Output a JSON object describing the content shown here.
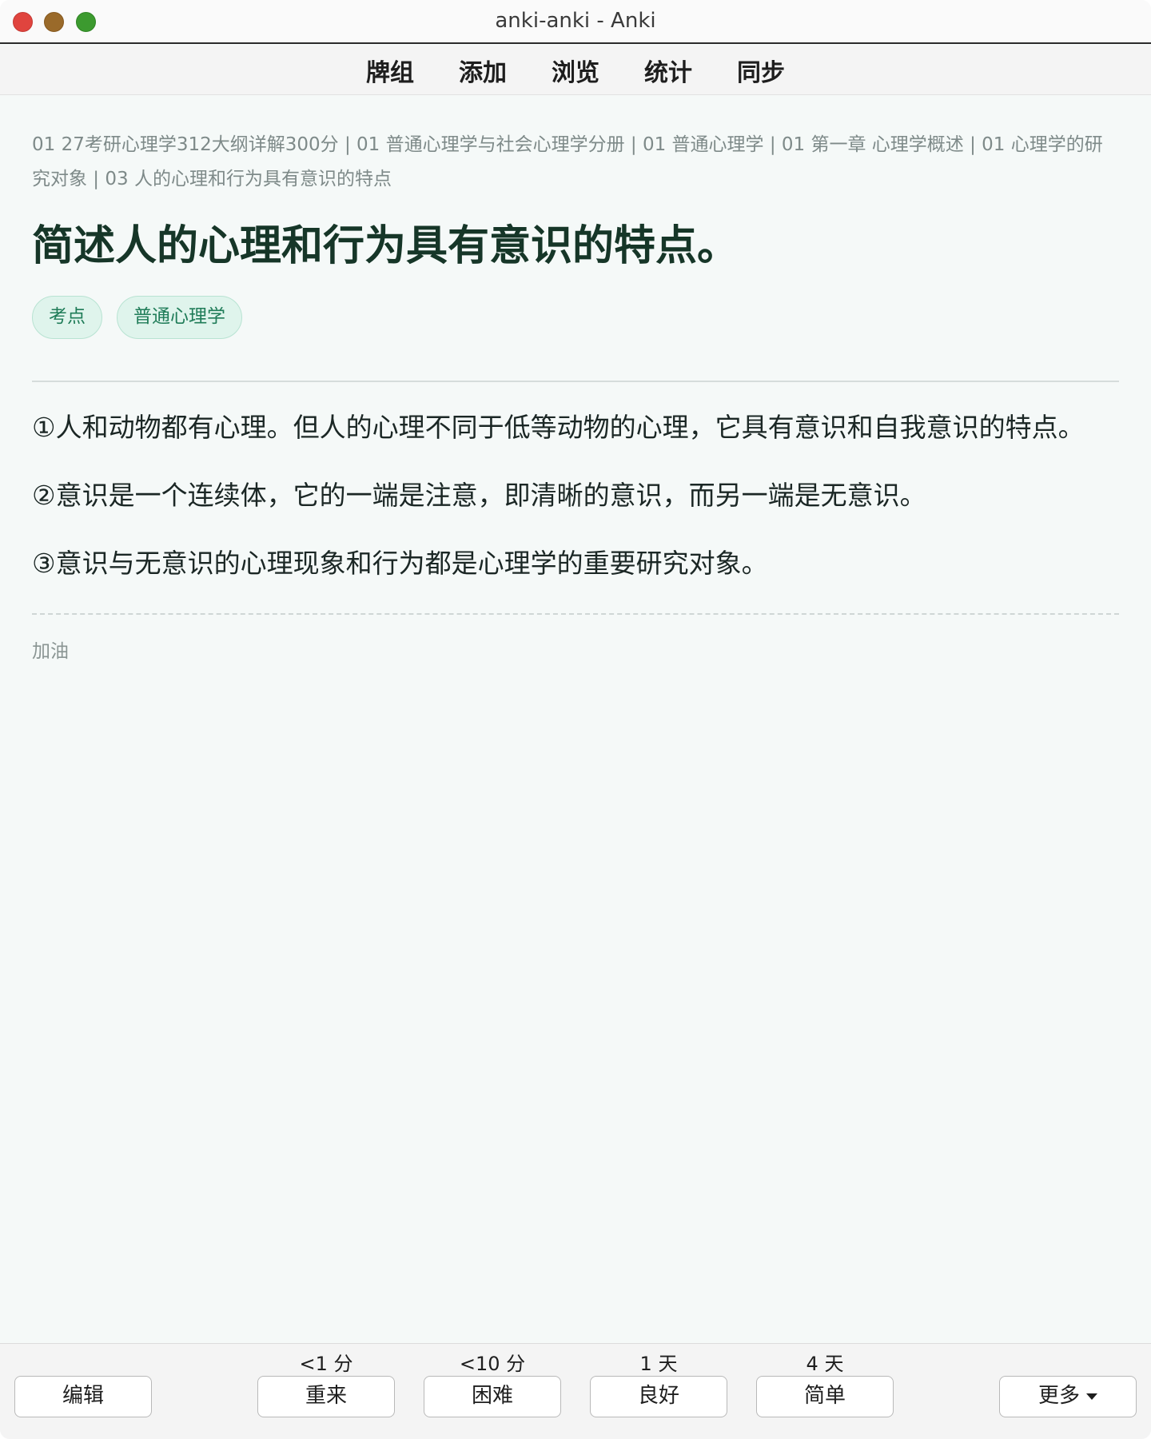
{
  "window": {
    "title": "anki-anki - Anki"
  },
  "nav": {
    "items": [
      "牌组",
      "添加",
      "浏览",
      "统计",
      "同步"
    ]
  },
  "card": {
    "breadcrumb": "01 27考研心理学312大纲详解300分 | 01 普通心理学与社会心理学分册 | 01 普通心理学 | 01 第一章 心理学概述 | 01 心理学的研究对象 | 03 人的心理和行为具有意识的特点",
    "question": "简述人的心理和行为具有意识的特点。",
    "tags": [
      "考点",
      "普通心理学"
    ],
    "answers": [
      "①人和动物都有心理。但人的心理不同于低等动物的心理，它具有意识和自我意识的特点。",
      "②意识是一个连续体，它的一端是注意，即清晰的意识，而另一端是无意识。",
      "③意识与无意识的心理现象和行为都是心理学的重要研究对象。"
    ],
    "note": "加油"
  },
  "bottom": {
    "edit_label": "编辑",
    "more_label": "更多",
    "answer_buttons": [
      {
        "label": "重来",
        "interval": "<1 分"
      },
      {
        "label": "困难",
        "interval": "<10 分"
      },
      {
        "label": "良好",
        "interval": "1 天"
      },
      {
        "label": "简单",
        "interval": "4 天"
      }
    ]
  }
}
